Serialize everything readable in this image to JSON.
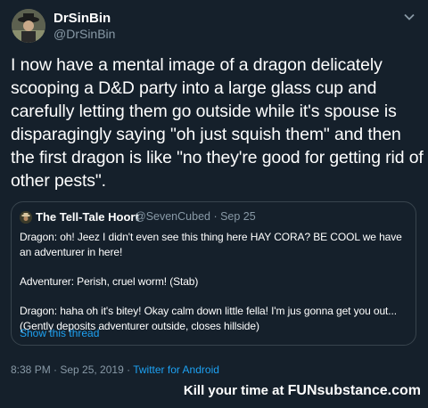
{
  "author": {
    "display_name": "DrSinBin",
    "handle": "@DrSinBin"
  },
  "tweet": {
    "text": "I now have a mental image of a dragon delicately scooping a D&D party into a large glass cup and carefully letting them go outside while it's spouse is disparagingly saying \"oh just squish them\" and then the first dragon is like \"no they're good for getting rid of other pests\"."
  },
  "quoted": {
    "display_name": "The Tell-Tale Hoort",
    "handle_date": "@SevenCubed · Sep 25",
    "lines": [
      "Dragon: oh! Jeez I didn't even see this thing here HAY CORA? BE COOL we have an adventurer in here!",
      "Adventurer: Perish, cruel worm! (Stab)",
      "Dragon: haha oh it's bitey! Okay calm down little fella! I'm jus gonna get you out... (Gently deposits adventurer outside, closes hillside)"
    ],
    "show_thread": "Show this thread"
  },
  "meta": {
    "timestamp": "8:38 PM · Sep 25, 2019 · ",
    "source": "Twitter for Android"
  },
  "watermark": {
    "lead": "Kill your time at ",
    "fun": "FUN",
    "sub": "substance.com"
  },
  "colors": {
    "background": "#15202b",
    "muted": "#8899a6",
    "link": "#1da1f2",
    "border": "#38444d"
  },
  "icons": {
    "menu": "chevron-down-icon"
  }
}
